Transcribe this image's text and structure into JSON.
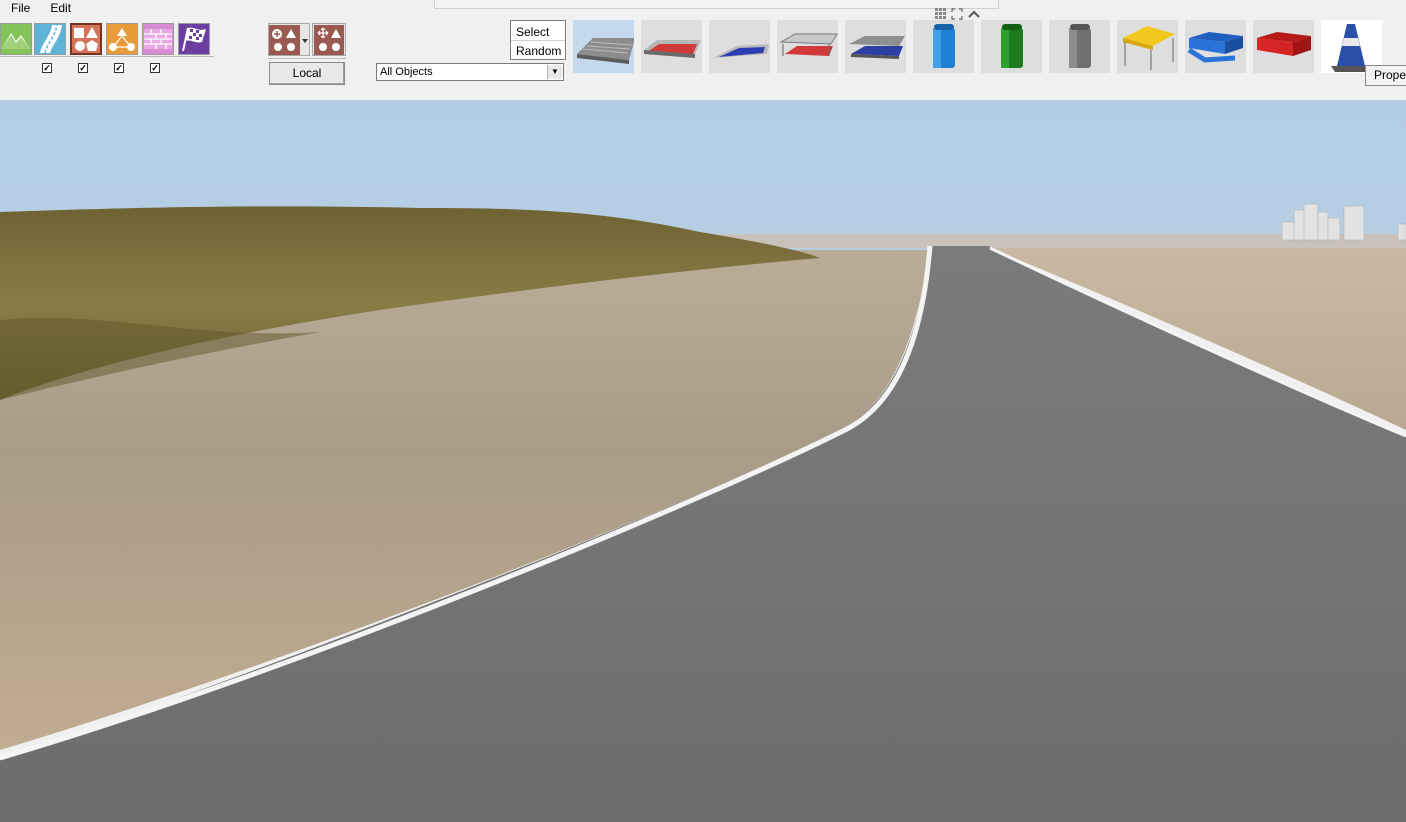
{
  "menu": {
    "items": [
      "File",
      "Edit"
    ]
  },
  "tool_groups": {
    "tools": [
      {
        "name": "terrain",
        "checked": true
      },
      {
        "name": "road",
        "checked": true
      },
      {
        "name": "objects",
        "checked": true
      },
      {
        "name": "layout",
        "checked": true
      },
      {
        "name": "walls",
        "checked": null
      },
      {
        "name": "race-flag",
        "checked": null
      }
    ]
  },
  "transform": {
    "local_label": "Local"
  },
  "object_filter": {
    "value": "All Objects"
  },
  "placement_mode": {
    "select_label": "Select",
    "random_label": "Random"
  },
  "assets": [
    {
      "name": "grandstand-grey",
      "checked": true,
      "selected": true
    },
    {
      "name": "grandstand-red",
      "checked": false
    },
    {
      "name": "grandstand-blue-low",
      "checked": false
    },
    {
      "name": "grandstand-red-roof",
      "checked": false
    },
    {
      "name": "grandstand-blue-roof",
      "checked": false
    },
    {
      "name": "portable-toilet-blue",
      "checked": false
    },
    {
      "name": "portable-toilet-green",
      "checked": false
    },
    {
      "name": "portable-toilet-grey",
      "checked": false
    },
    {
      "name": "tent-yellow",
      "checked": false
    },
    {
      "name": "banner-blue",
      "checked": false
    },
    {
      "name": "banner-red",
      "checked": false
    },
    {
      "name": "traffic-cone",
      "checked": false
    }
  ],
  "properties_label": "Proper",
  "colors": {
    "sky": "#b4cde4",
    "asphalt": "#6e6f70",
    "grass": "#7a6f3b",
    "sand": "#b5a894",
    "selected_asset": "#c4d9ee"
  }
}
